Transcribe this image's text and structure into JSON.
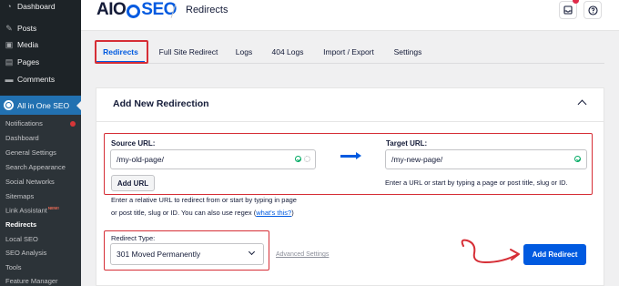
{
  "sidebar": {
    "wp_items": [
      {
        "label": "Dashboard",
        "icon": "dashboard-icon"
      },
      {
        "label": "Posts",
        "icon": "pin-icon"
      },
      {
        "label": "Media",
        "icon": "media-icon"
      },
      {
        "label": "Pages",
        "icon": "pages-icon"
      },
      {
        "label": "Comments",
        "icon": "comments-icon"
      }
    ],
    "aioseo_label": "All in One SEO",
    "submenu": [
      "Notifications",
      "Dashboard",
      "General Settings",
      "Search Appearance",
      "Social Networks",
      "Sitemaps",
      "Link Assistant",
      "Redirects",
      "Local SEO",
      "SEO Analysis",
      "Tools",
      "Feature Manager"
    ],
    "new_badge": "NEW!",
    "active_item": "Redirects"
  },
  "header": {
    "logo_a": "AIO",
    "logo_b": "SEO",
    "title": "Redirects"
  },
  "tabs": [
    "Redirects",
    "Full Site Redirect",
    "Logs",
    "404 Logs",
    "Import / Export",
    "Settings"
  ],
  "card": {
    "title": "Add New Redirection",
    "source_label": "Source URL:",
    "source_value": "/my-old-page/",
    "add_url_label": "Add URL",
    "source_help_line1": "Enter a relative URL to redirect from or start by typing in page",
    "source_help_line2": "or post title, slug or ID. You can also use regex (",
    "source_help_link": "what's this?",
    "source_help_end": ")",
    "target_label": "Target URL:",
    "target_value": "/my-new-page/",
    "target_help": "Enter a URL or start by typing a page or post title, slug or ID.",
    "redirect_type_label": "Redirect Type:",
    "redirect_type_value": "301 Moved Permanently",
    "advanced_settings_label": "Advanced Settings",
    "add_redirect_label": "Add Redirect"
  },
  "colors": {
    "accent": "#005ae0",
    "highlight": "#d62e36",
    "wp_active": "#2271b1"
  }
}
